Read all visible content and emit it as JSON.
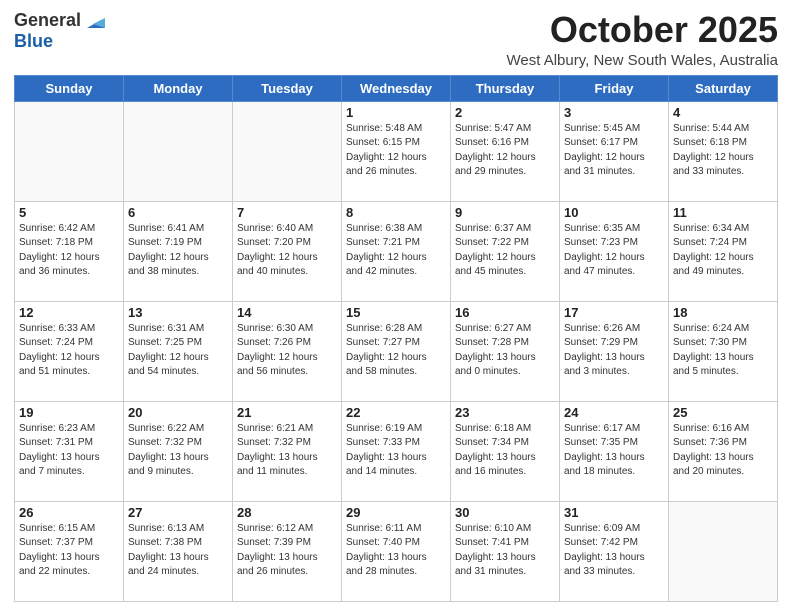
{
  "header": {
    "logo_general": "General",
    "logo_blue": "Blue",
    "month": "October 2025",
    "location": "West Albury, New South Wales, Australia"
  },
  "days_of_week": [
    "Sunday",
    "Monday",
    "Tuesday",
    "Wednesday",
    "Thursday",
    "Friday",
    "Saturday"
  ],
  "weeks": [
    [
      {
        "day": "",
        "info": ""
      },
      {
        "day": "",
        "info": ""
      },
      {
        "day": "",
        "info": ""
      },
      {
        "day": "1",
        "info": "Sunrise: 5:48 AM\nSunset: 6:15 PM\nDaylight: 12 hours\nand 26 minutes."
      },
      {
        "day": "2",
        "info": "Sunrise: 5:47 AM\nSunset: 6:16 PM\nDaylight: 12 hours\nand 29 minutes."
      },
      {
        "day": "3",
        "info": "Sunrise: 5:45 AM\nSunset: 6:17 PM\nDaylight: 12 hours\nand 31 minutes."
      },
      {
        "day": "4",
        "info": "Sunrise: 5:44 AM\nSunset: 6:18 PM\nDaylight: 12 hours\nand 33 minutes."
      }
    ],
    [
      {
        "day": "5",
        "info": "Sunrise: 6:42 AM\nSunset: 7:18 PM\nDaylight: 12 hours\nand 36 minutes."
      },
      {
        "day": "6",
        "info": "Sunrise: 6:41 AM\nSunset: 7:19 PM\nDaylight: 12 hours\nand 38 minutes."
      },
      {
        "day": "7",
        "info": "Sunrise: 6:40 AM\nSunset: 7:20 PM\nDaylight: 12 hours\nand 40 minutes."
      },
      {
        "day": "8",
        "info": "Sunrise: 6:38 AM\nSunset: 7:21 PM\nDaylight: 12 hours\nand 42 minutes."
      },
      {
        "day": "9",
        "info": "Sunrise: 6:37 AM\nSunset: 7:22 PM\nDaylight: 12 hours\nand 45 minutes."
      },
      {
        "day": "10",
        "info": "Sunrise: 6:35 AM\nSunset: 7:23 PM\nDaylight: 12 hours\nand 47 minutes."
      },
      {
        "day": "11",
        "info": "Sunrise: 6:34 AM\nSunset: 7:24 PM\nDaylight: 12 hours\nand 49 minutes."
      }
    ],
    [
      {
        "day": "12",
        "info": "Sunrise: 6:33 AM\nSunset: 7:24 PM\nDaylight: 12 hours\nand 51 minutes."
      },
      {
        "day": "13",
        "info": "Sunrise: 6:31 AM\nSunset: 7:25 PM\nDaylight: 12 hours\nand 54 minutes."
      },
      {
        "day": "14",
        "info": "Sunrise: 6:30 AM\nSunset: 7:26 PM\nDaylight: 12 hours\nand 56 minutes."
      },
      {
        "day": "15",
        "info": "Sunrise: 6:28 AM\nSunset: 7:27 PM\nDaylight: 12 hours\nand 58 minutes."
      },
      {
        "day": "16",
        "info": "Sunrise: 6:27 AM\nSunset: 7:28 PM\nDaylight: 13 hours\nand 0 minutes."
      },
      {
        "day": "17",
        "info": "Sunrise: 6:26 AM\nSunset: 7:29 PM\nDaylight: 13 hours\nand 3 minutes."
      },
      {
        "day": "18",
        "info": "Sunrise: 6:24 AM\nSunset: 7:30 PM\nDaylight: 13 hours\nand 5 minutes."
      }
    ],
    [
      {
        "day": "19",
        "info": "Sunrise: 6:23 AM\nSunset: 7:31 PM\nDaylight: 13 hours\nand 7 minutes."
      },
      {
        "day": "20",
        "info": "Sunrise: 6:22 AM\nSunset: 7:32 PM\nDaylight: 13 hours\nand 9 minutes."
      },
      {
        "day": "21",
        "info": "Sunrise: 6:21 AM\nSunset: 7:32 PM\nDaylight: 13 hours\nand 11 minutes."
      },
      {
        "day": "22",
        "info": "Sunrise: 6:19 AM\nSunset: 7:33 PM\nDaylight: 13 hours\nand 14 minutes."
      },
      {
        "day": "23",
        "info": "Sunrise: 6:18 AM\nSunset: 7:34 PM\nDaylight: 13 hours\nand 16 minutes."
      },
      {
        "day": "24",
        "info": "Sunrise: 6:17 AM\nSunset: 7:35 PM\nDaylight: 13 hours\nand 18 minutes."
      },
      {
        "day": "25",
        "info": "Sunrise: 6:16 AM\nSunset: 7:36 PM\nDaylight: 13 hours\nand 20 minutes."
      }
    ],
    [
      {
        "day": "26",
        "info": "Sunrise: 6:15 AM\nSunset: 7:37 PM\nDaylight: 13 hours\nand 22 minutes."
      },
      {
        "day": "27",
        "info": "Sunrise: 6:13 AM\nSunset: 7:38 PM\nDaylight: 13 hours\nand 24 minutes."
      },
      {
        "day": "28",
        "info": "Sunrise: 6:12 AM\nSunset: 7:39 PM\nDaylight: 13 hours\nand 26 minutes."
      },
      {
        "day": "29",
        "info": "Sunrise: 6:11 AM\nSunset: 7:40 PM\nDaylight: 13 hours\nand 28 minutes."
      },
      {
        "day": "30",
        "info": "Sunrise: 6:10 AM\nSunset: 7:41 PM\nDaylight: 13 hours\nand 31 minutes."
      },
      {
        "day": "31",
        "info": "Sunrise: 6:09 AM\nSunset: 7:42 PM\nDaylight: 13 hours\nand 33 minutes."
      },
      {
        "day": "",
        "info": ""
      }
    ]
  ]
}
